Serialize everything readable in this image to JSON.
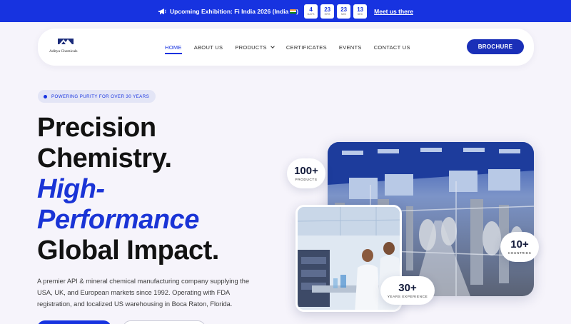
{
  "announcement": {
    "text": "Upcoming Exhibition: Fi India 2026 (India",
    "countdown": [
      {
        "value": "4",
        "label": "DAYS"
      },
      {
        "value": "23",
        "label": "HRS"
      },
      {
        "value": "23",
        "label": "MIN"
      },
      {
        "value": "13",
        "label": "SEC"
      }
    ],
    "link": "Meet us there",
    "icon": "megaphone-icon"
  },
  "nav": {
    "logo_text": "Aditya Chemicals",
    "links": [
      "HOME",
      "ABOUT US",
      "PRODUCTS",
      "CERTIFICATES",
      "EVENTS",
      "CONTACT US"
    ],
    "active": "HOME",
    "brochure": "BROCHURE"
  },
  "hero": {
    "badge": "POWERING PURITY FOR OVER 30 YEARS",
    "headline": [
      "Precision",
      "Chemistry.",
      "High-",
      "Performance",
      "Global Impact."
    ],
    "description": "A premier API & mineral chemical manufacturing company supplying the USA, UK, and European markets since 1992. Operating with FDA registration, and localized US warehousing in Boca Raton, Florida."
  },
  "stats": {
    "products": {
      "value": "100+",
      "label": "PRODUCTS"
    },
    "countries": {
      "value": "10+",
      "label": "COUNTRIES"
    },
    "years": {
      "value": "30+",
      "label": "YEARS EXPERIENCE"
    }
  },
  "colors": {
    "brand": "#1733e0",
    "navy": "#1a2fb8",
    "background": "#f6f4fb"
  }
}
